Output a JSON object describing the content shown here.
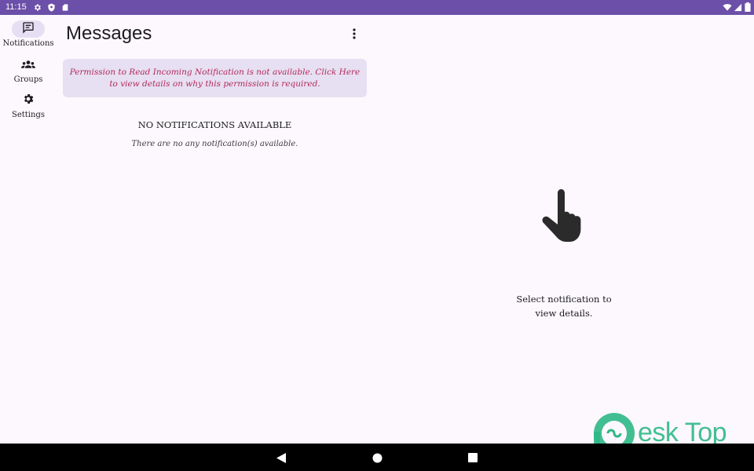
{
  "status_bar": {
    "time": "11:15",
    "icons": [
      "gear-icon",
      "shield-icon",
      "sd-card-icon",
      "wifi-icon",
      "signal-icon",
      "battery-icon"
    ]
  },
  "nav_rail": {
    "items": [
      {
        "label": "Notifications",
        "icon": "message-icon",
        "active": true
      },
      {
        "label": "Groups",
        "icon": "groups-icon",
        "active": false
      },
      {
        "label": "Settings",
        "icon": "gear-icon",
        "active": false
      }
    ]
  },
  "header": {
    "title": "Messages",
    "menu_icon": "more-vert-icon"
  },
  "permission_banner": {
    "text": "Permission to Read Incoming Notification is not available. Click Here to view details on why this permission is required."
  },
  "empty_state": {
    "title": "NO NOTIFICATIONS AVAILABLE",
    "subtitle": "There are no any notification(s) available."
  },
  "detail_pane": {
    "icon": "pointing-hand-icon",
    "hint": "Select notification to\nview details."
  },
  "watermark": {
    "text": "esk Top"
  },
  "system_nav": {
    "buttons": [
      "back-icon",
      "home-icon",
      "recents-icon"
    ]
  },
  "colors": {
    "status_bar": "#6b4fa8",
    "background": "#fdf8fd",
    "active_pill": "#e6dff4",
    "banner_bg": "#e7dff2",
    "banner_text": "#b22a5a",
    "watermark": "#2eb886"
  }
}
